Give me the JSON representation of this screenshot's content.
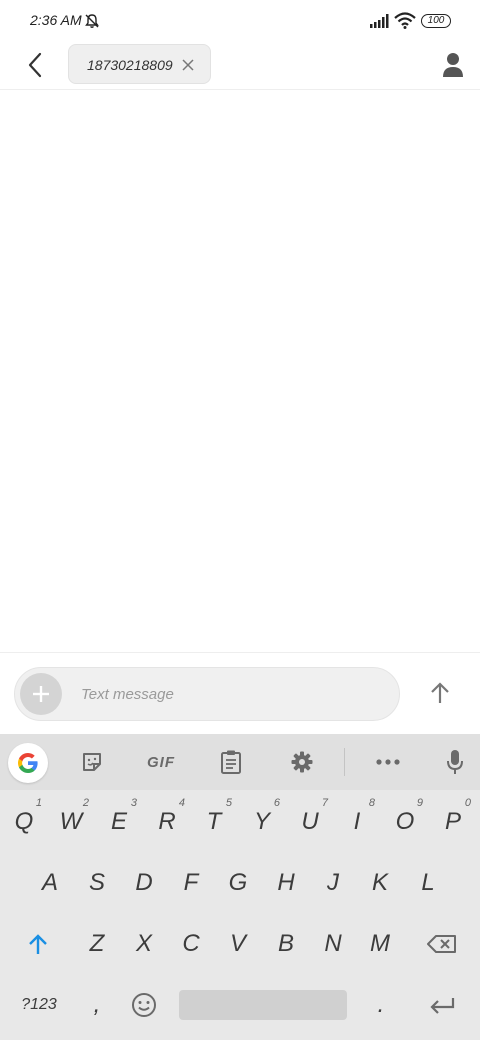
{
  "status_bar": {
    "time": "2:36 AM",
    "battery": "100",
    "icons": [
      "mute-bell-icon",
      "cell-signal-icon",
      "wifi-icon",
      "battery-icon"
    ]
  },
  "header": {
    "back_icon": "back-arrow-icon",
    "recipient": "18730218809",
    "remove_icon": "close-icon",
    "contact_icon": "person-icon"
  },
  "compose": {
    "placeholder": "Text message",
    "value": "",
    "attach_icon": "plus-icon",
    "send_icon": "up-arrow-icon"
  },
  "keyboard": {
    "toolbar": [
      "google-icon",
      "sticker-icon",
      "GIF",
      "clipboard-icon",
      "gear-icon",
      "more-icon",
      "mic-icon"
    ],
    "gif_label": "GIF",
    "row1": [
      {
        "key": "Q",
        "hint": "1"
      },
      {
        "key": "W",
        "hint": "2"
      },
      {
        "key": "E",
        "hint": "3"
      },
      {
        "key": "R",
        "hint": "4"
      },
      {
        "key": "T",
        "hint": "5"
      },
      {
        "key": "Y",
        "hint": "6"
      },
      {
        "key": "U",
        "hint": "7"
      },
      {
        "key": "I",
        "hint": "8"
      },
      {
        "key": "O",
        "hint": "9"
      },
      {
        "key": "P",
        "hint": "0"
      }
    ],
    "row2": [
      "A",
      "S",
      "D",
      "F",
      "G",
      "H",
      "J",
      "K",
      "L"
    ],
    "row3": [
      "Z",
      "X",
      "C",
      "V",
      "B",
      "N",
      "M"
    ],
    "symbols_label": "?123",
    "comma": ",",
    "period": ".",
    "accent_color": "#1a8fe3"
  }
}
